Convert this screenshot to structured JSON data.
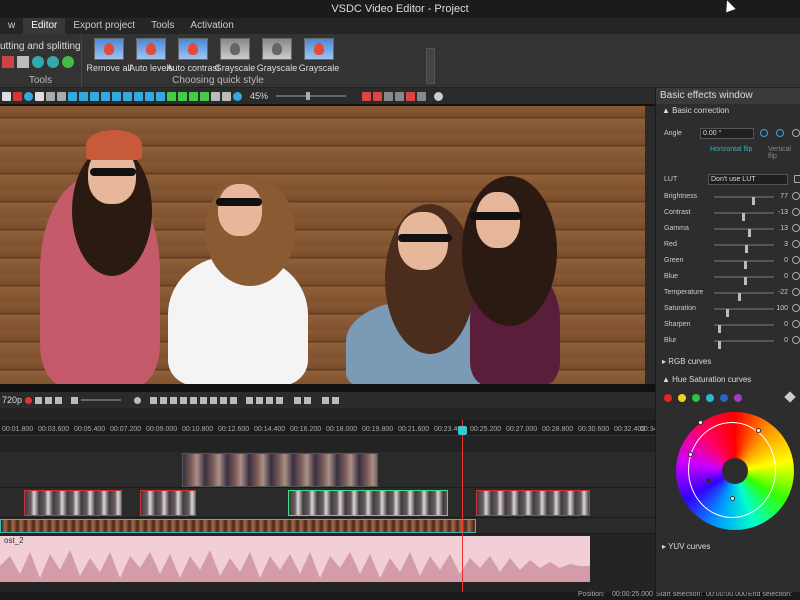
{
  "window": {
    "title": "VSDC Video Editor - Project"
  },
  "menu": {
    "tabs": [
      "w",
      "Editor",
      "Export project",
      "Tools",
      "Activation"
    ],
    "active": "Editor"
  },
  "ribbon": {
    "tools_heading": "utting and splitting",
    "tools_label": "Tools",
    "quick_style_label": "Choosing quick style",
    "quick_styles": [
      "Remove all",
      "Auto levels",
      "Auto contrast",
      "Grayscale",
      "Grayscale",
      "Grayscale"
    ]
  },
  "toolbar": {
    "zoom": "45%"
  },
  "playbar": {
    "resolution": "720p"
  },
  "timeline": {
    "ticks": [
      "00:01.800",
      "00:03.600",
      "00:05.400",
      "00:07.200",
      "00:09.000",
      "00:10.800",
      "00:12.600",
      "00:14.400",
      "00:16.200",
      "00:18.000",
      "00:19.800",
      "00:21.600",
      "00:23.400",
      "00:25.200",
      "00:27.000",
      "00:28.800",
      "00:30.600",
      "00:32.400",
      "00:34.20"
    ],
    "audio_label": "ost_2"
  },
  "status": {
    "position_label": "Position:",
    "position_value": "00:00:25.000",
    "start_label": "Start selection:",
    "start_value": "00:00:00.000",
    "end_label": "End selection:"
  },
  "panel": {
    "title": "Basic effects window",
    "basic_correction": "Basic correction",
    "angle_label": "Angle",
    "angle_value": "0.00 °",
    "hflip": "Horizontal flip",
    "vflip": "Vertical flip",
    "lut_label": "LUT",
    "lut_value": "Don't use LUT",
    "sliders": [
      {
        "label": "Brightness",
        "value": "77"
      },
      {
        "label": "Contrast",
        "value": "-13"
      },
      {
        "label": "Gamma",
        "value": "13"
      },
      {
        "label": "Red",
        "value": "3"
      },
      {
        "label": "Green",
        "value": "0"
      },
      {
        "label": "Blue",
        "value": "0"
      },
      {
        "label": "Temperature",
        "value": "-22"
      },
      {
        "label": "Saturation",
        "value": "100"
      },
      {
        "label": "Sharpen",
        "value": "0"
      },
      {
        "label": "Blur",
        "value": "0"
      }
    ],
    "rgb_curves": "RGB curves",
    "hue_sat_curves": "Hue Saturation curves",
    "yuv_curves": "YUV curves",
    "swatch_colors": [
      "#e0242b",
      "#f0d21e",
      "#2fbf4a",
      "#2fb5d5",
      "#2a62c8",
      "#9b3fc0"
    ]
  },
  "colors": {
    "accent": "#3cc8c8",
    "playhead": "#e33333"
  }
}
